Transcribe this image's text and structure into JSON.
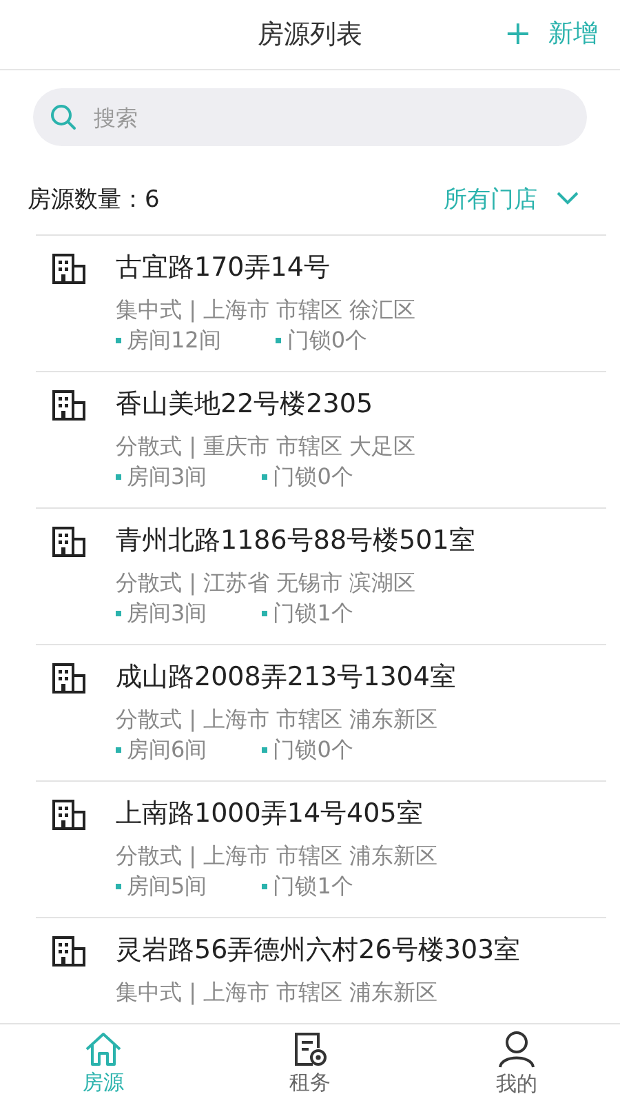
{
  "header": {
    "title": "房源列表",
    "action": {
      "icon": "+",
      "label": "新增"
    }
  },
  "search": {
    "placeholder": "搜索"
  },
  "summary": {
    "count": "房源数量：6",
    "filter": "所有门店"
  },
  "properties": [
    {
      "title": "古宜路170弄14号",
      "info": "集中式 | 上海市 市辖区 徐汇区",
      "rooms": "房间12间",
      "locks": "门锁0个"
    },
    {
      "title": "香山美地22号楼2305",
      "info": "分散式 | 重庆市 市辖区 大足区",
      "rooms": "房间3间",
      "locks": "门锁0个"
    },
    {
      "title": "青州北路1186号88号楼501室",
      "info": "分散式 | 江苏省 无锡市 滨湖区",
      "rooms": "房间3间",
      "locks": "门锁1个"
    },
    {
      "title": "成山路2008弄213号1304室",
      "info": "分散式 | 上海市 市辖区 浦东新区",
      "rooms": "房间6间",
      "locks": "门锁0个"
    },
    {
      "title": "上南路1000弄14号405室",
      "info": "分散式 | 上海市 市辖区 浦东新区",
      "rooms": "房间5间",
      "locks": "门锁1个"
    },
    {
      "title": "灵岩路56弄德州六村26号楼303室",
      "info": "集中式 | 上海市 市辖区 浦东新区"
    }
  ],
  "tabbar": [
    {
      "kind": "home",
      "label": "房源",
      "selected": true
    },
    {
      "kind": "lease",
      "label": "租务",
      "selected": false
    },
    {
      "kind": "profile",
      "label": "我的",
      "selected": false
    }
  ]
}
